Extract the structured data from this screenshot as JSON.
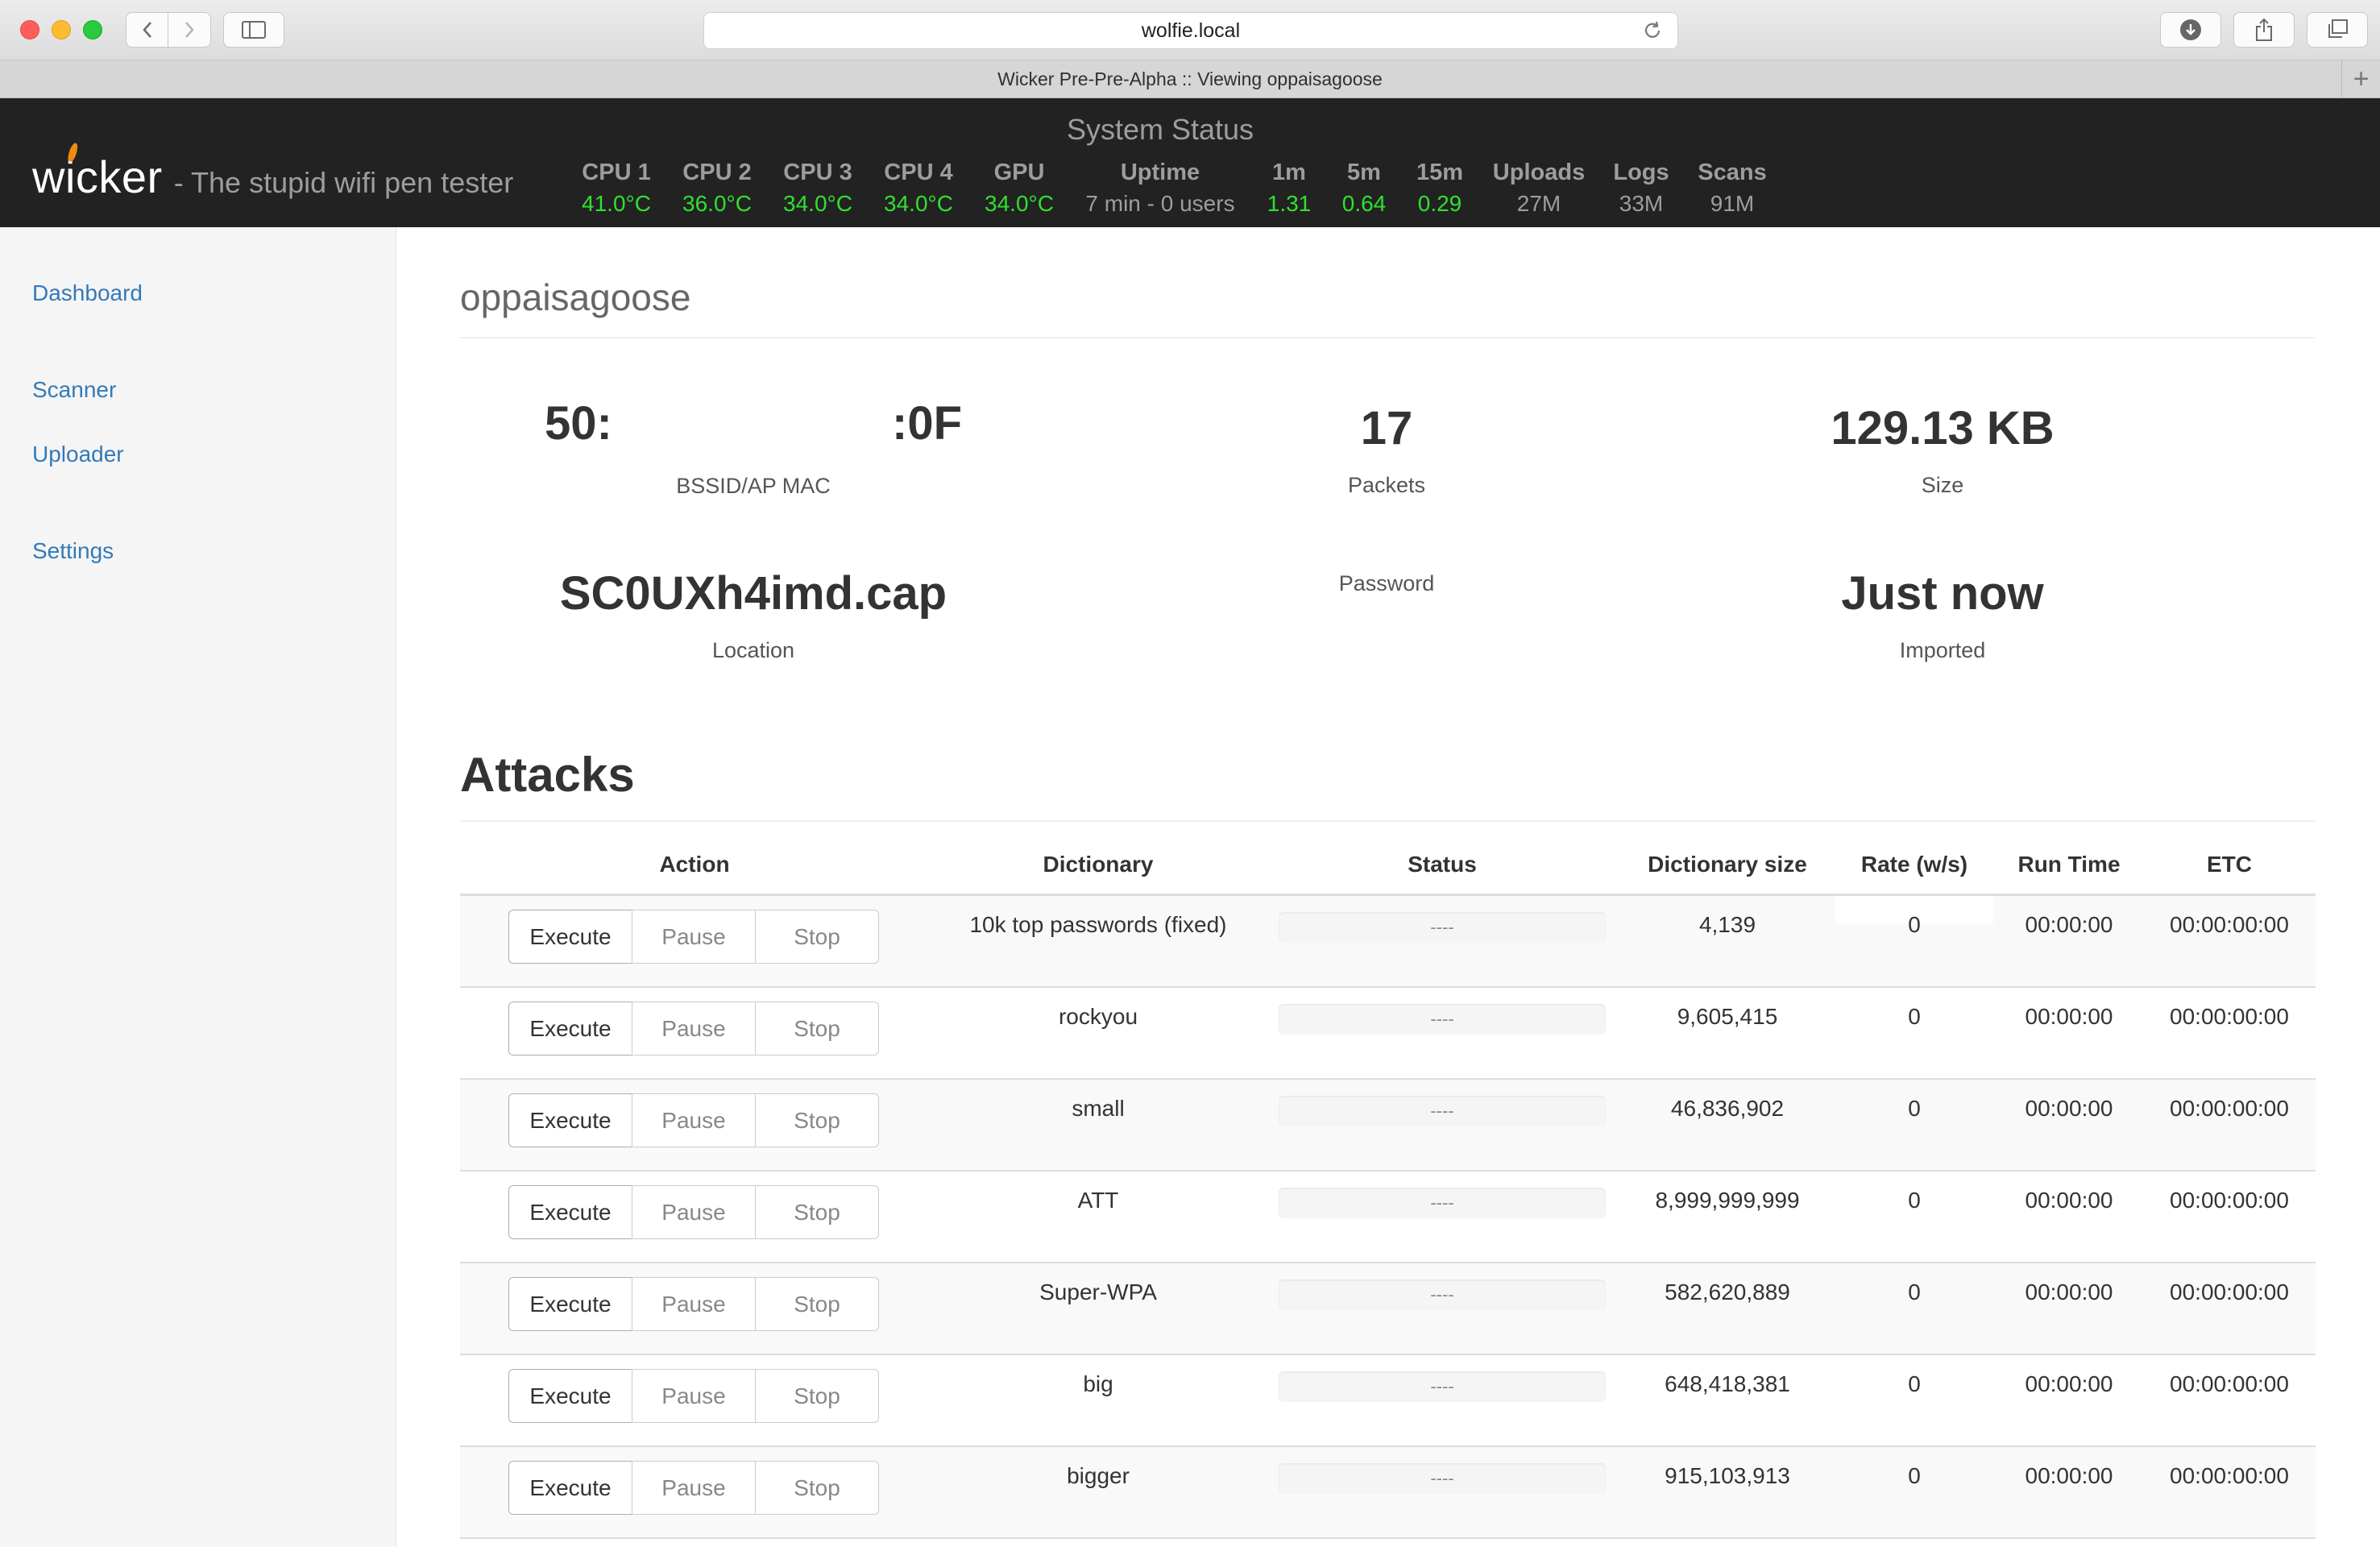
{
  "browser": {
    "url": "wolfie.local",
    "tab_title": "Wicker Pre-Pre-Alpha :: Viewing oppaisagoose"
  },
  "header": {
    "brand": "wicker",
    "tagline": "- The stupid wifi pen tester",
    "system_status_title": "System Status",
    "stats": [
      {
        "label": "CPU 1",
        "value": "41.0°C",
        "color": "green"
      },
      {
        "label": "CPU 2",
        "value": "36.0°C",
        "color": "green"
      },
      {
        "label": "CPU 3",
        "value": "34.0°C",
        "color": "green"
      },
      {
        "label": "CPU 4",
        "value": "34.0°C",
        "color": "green"
      },
      {
        "label": "GPU",
        "value": "34.0°C",
        "color": "green"
      },
      {
        "label": "Uptime",
        "value": "7 min - 0 users",
        "color": "gray"
      },
      {
        "label": "1m",
        "value": "1.31",
        "color": "green"
      },
      {
        "label": "5m",
        "value": "0.64",
        "color": "green"
      },
      {
        "label": "15m",
        "value": "0.29",
        "color": "green"
      },
      {
        "label": "Uploads",
        "value": "27M",
        "color": "gray"
      },
      {
        "label": "Logs",
        "value": "33M",
        "color": "gray"
      },
      {
        "label": "Scans",
        "value": "91M",
        "color": "gray"
      }
    ]
  },
  "sidebar": {
    "items": [
      {
        "label": "Dashboard"
      },
      {
        "label": "Scanner"
      },
      {
        "label": "Uploader"
      },
      {
        "label": "Settings"
      }
    ]
  },
  "main": {
    "title": "oppaisagoose",
    "info": {
      "bssid_left": "50:",
      "bssid_right": ":0F",
      "bssid_label": "BSSID/AP MAC",
      "packets": "17",
      "packets_label": "Packets",
      "size": "129.13 KB",
      "size_label": "Size",
      "location": "SC0UXh4imd.cap",
      "location_label": "Location",
      "password_label": "Password",
      "imported": "Just now",
      "imported_label": "Imported"
    },
    "attacks_title": "Attacks",
    "table": {
      "headers": [
        "Action",
        "Dictionary",
        "Status",
        "Dictionary size",
        "Rate (w/s)",
        "Run Time",
        "ETC"
      ],
      "buttons": {
        "execute": "Execute",
        "pause": "Pause",
        "stop": "Stop"
      },
      "rows": [
        {
          "dictionary": "10k top passwords (fixed)",
          "status": "----",
          "size": "4,139",
          "rate": "0",
          "runtime": "00:00:00",
          "etc": "00:00:00:00"
        },
        {
          "dictionary": "rockyou",
          "status": "----",
          "size": "9,605,415",
          "rate": "0",
          "runtime": "00:00:00",
          "etc": "00:00:00:00"
        },
        {
          "dictionary": "small",
          "status": "----",
          "size": "46,836,902",
          "rate": "0",
          "runtime": "00:00:00",
          "etc": "00:00:00:00"
        },
        {
          "dictionary": "ATT",
          "status": "----",
          "size": "8,999,999,999",
          "rate": "0",
          "runtime": "00:00:00",
          "etc": "00:00:00:00"
        },
        {
          "dictionary": "Super-WPA",
          "status": "----",
          "size": "582,620,889",
          "rate": "0",
          "runtime": "00:00:00",
          "etc": "00:00:00:00"
        },
        {
          "dictionary": "big",
          "status": "----",
          "size": "648,418,381",
          "rate": "0",
          "runtime": "00:00:00",
          "etc": "00:00:00:00"
        },
        {
          "dictionary": "bigger",
          "status": "----",
          "size": "915,103,913",
          "rate": "0",
          "runtime": "00:00:00",
          "etc": "00:00:00:00"
        }
      ]
    }
  },
  "colors": {
    "header_bg": "#222222",
    "accent_link": "#337ab7",
    "status_green": "#30e030",
    "muted": "#9d9d9d"
  },
  "icons": {
    "back": "chevron-left-icon",
    "forward": "chevron-right-icon",
    "sidebar": "sidebar-icon",
    "reload": "reload-icon",
    "download": "download-icon",
    "share": "share-icon",
    "tabs": "tabs-icon",
    "new_tab": "plus-icon"
  }
}
